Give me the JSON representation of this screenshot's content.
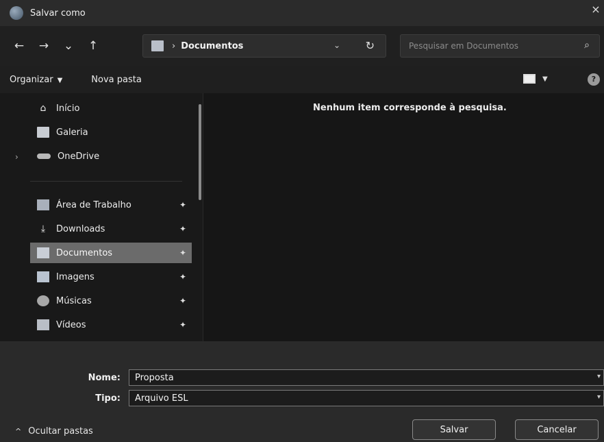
{
  "window": {
    "title": "Salvar como",
    "close_glyph": "×"
  },
  "navigation": {
    "back_glyph": "←",
    "forward_glyph": "→",
    "recent_glyph": "⌄",
    "up_glyph": "↑",
    "separator": "›",
    "current_folder": "Documentos",
    "dropdown_glyph": "⌄",
    "refresh_glyph": "↻",
    "search_placeholder": "Pesquisar em Documentos",
    "search_glyph": "⌕"
  },
  "commands": {
    "organize_label": "Organizar",
    "new_folder_label": "Nova pasta",
    "help_glyph": "?"
  },
  "sidebar": {
    "items": [
      {
        "label": "Início",
        "icon": "home-icon"
      },
      {
        "label": "Galeria",
        "icon": "gallery-icon"
      },
      {
        "label": "OneDrive",
        "icon": "cloud-icon"
      },
      {
        "label": "Área de Trabalho",
        "icon": "desktop-icon",
        "pinned": true
      },
      {
        "label": "Downloads",
        "icon": "download-icon",
        "pinned": true
      },
      {
        "label": "Documentos",
        "icon": "documents-icon",
        "pinned": true,
        "selected": true
      },
      {
        "label": "Imagens",
        "icon": "images-icon",
        "pinned": true
      },
      {
        "label": "Músicas",
        "icon": "music-icon",
        "pinned": true
      },
      {
        "label": "Vídeos",
        "icon": "video-icon",
        "pinned": true
      }
    ],
    "expand_glyph": "›",
    "pin_glyph": "📌"
  },
  "content": {
    "empty_message": "Nenhum item corresponde à pesquisa."
  },
  "form": {
    "name_label": "Nome:",
    "name_value": "Proposta",
    "type_label": "Tipo:",
    "type_value": "Arquivo ESL",
    "hide_folders_label": "Ocultar pastas",
    "save_label": "Salvar",
    "cancel_label": "Cancelar"
  }
}
